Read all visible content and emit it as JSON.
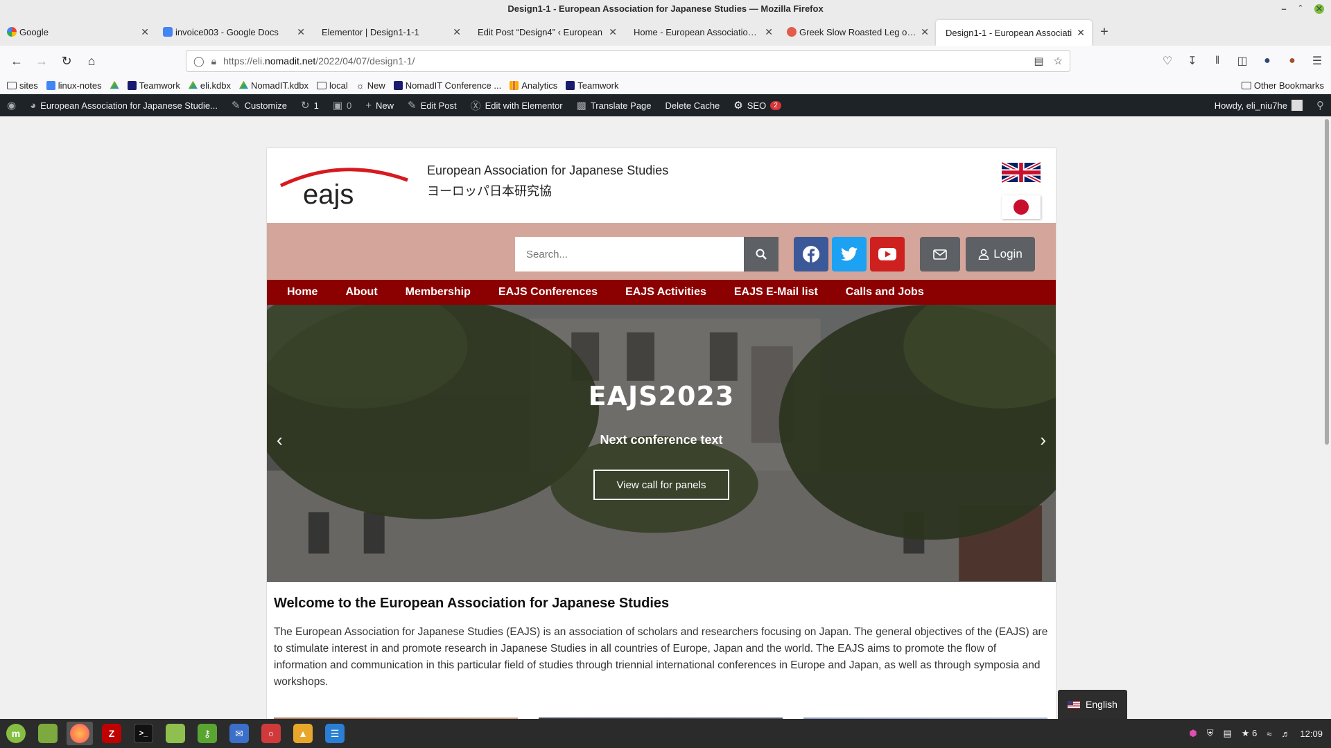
{
  "window": {
    "title": "Design1-1 - European Association for Japanese Studies — Mozilla Firefox"
  },
  "tabs": [
    {
      "label": "Google",
      "icon": "google-icon",
      "color": "#4285f4"
    },
    {
      "label": "invoice003 - Google Docs",
      "icon": "docs-icon",
      "color": "#4285f4"
    },
    {
      "label": "Elementor | Design1-1-1",
      "icon": "",
      "color": ""
    },
    {
      "label": "Edit Post “Design4” ‹ European",
      "icon": "",
      "color": ""
    },
    {
      "label": "Home - European Association fo",
      "icon": "",
      "color": ""
    },
    {
      "label": "Greek Slow Roasted Leg of La",
      "icon": "recipe-icon",
      "color": "#e35b4a"
    },
    {
      "label": "Design1-1 - European Associati",
      "icon": "",
      "color": "",
      "active": true
    }
  ],
  "url": {
    "prefix": "https://eli.",
    "host": "nomadit.net",
    "path": "/2022/04/07/design1-1/"
  },
  "bookmarks": [
    {
      "label": "sites",
      "type": "folder"
    },
    {
      "label": "linux-notes",
      "type": "doc",
      "color": "#4285f4"
    },
    {
      "label": "",
      "type": "drive",
      "color": "#fbbc04"
    },
    {
      "label": "Teamwork",
      "type": "site",
      "color": "#1a1a6e"
    },
    {
      "label": "eli.kdbx",
      "type": "drive",
      "color": "#34a853"
    },
    {
      "label": "NomadIT.kdbx",
      "type": "drive",
      "color": "#34a853"
    },
    {
      "label": "local",
      "type": "folder"
    },
    {
      "label": "New",
      "type": "globe"
    },
    {
      "label": "NomadIT Conference ...",
      "type": "site",
      "color": "#1a1a6e"
    },
    {
      "label": "Analytics",
      "type": "analytics",
      "color": "#f9ab00"
    },
    {
      "label": "Teamwork",
      "type": "site",
      "color": "#1a1a6e"
    }
  ],
  "bookmarks_right": "Other Bookmarks",
  "wpbar": {
    "site": "European Association for Japanese Studie...",
    "customize": "Customize",
    "updates": "1",
    "comments": "0",
    "new": "New",
    "edit_post": "Edit Post",
    "elementor": "Edit with Elementor",
    "translate": "Translate Page",
    "cache": "Delete Cache",
    "seo": "SEO",
    "seo_count": "2",
    "howdy": "Howdy, eli_niu7he"
  },
  "site": {
    "logo_text": "eajs",
    "name": "European Association for Japanese Studies",
    "name_jp": "ヨーロッパ日本研究協",
    "search_placeholder": "Search...",
    "login": "Login",
    "nav": [
      "Home",
      "About",
      "Membership",
      "EAJS Conferences",
      "EAJS Activities",
      "EAJS E-Mail list",
      "Calls and Jobs"
    ],
    "hero": {
      "title": "EAJS2023",
      "subtitle": "Next conference text",
      "button": "View call for panels"
    },
    "welcome_title": "Welcome to the European Association for Japanese Studies",
    "welcome_text": "The European Association for Japanese Studies (EAJS) is an association of scholars and researchers focusing on Japan. The general objectives of the (EAJS) are to stimulate interest in and promote research in Japanese Studies in all countries of Europe, Japan and the world. The EAJS aims to promote the flow of information and communication in this particular field of studies through triennial international conferences in Europe and Japan, as well as through symposia and workshops."
  },
  "language_switcher": "English",
  "taskbar": {
    "clock": "12:09",
    "notif_count": "6"
  },
  "colors": {
    "nav_red": "#8b0000",
    "pink_bar": "#d4a59a",
    "wp_dark": "#1d2327"
  }
}
